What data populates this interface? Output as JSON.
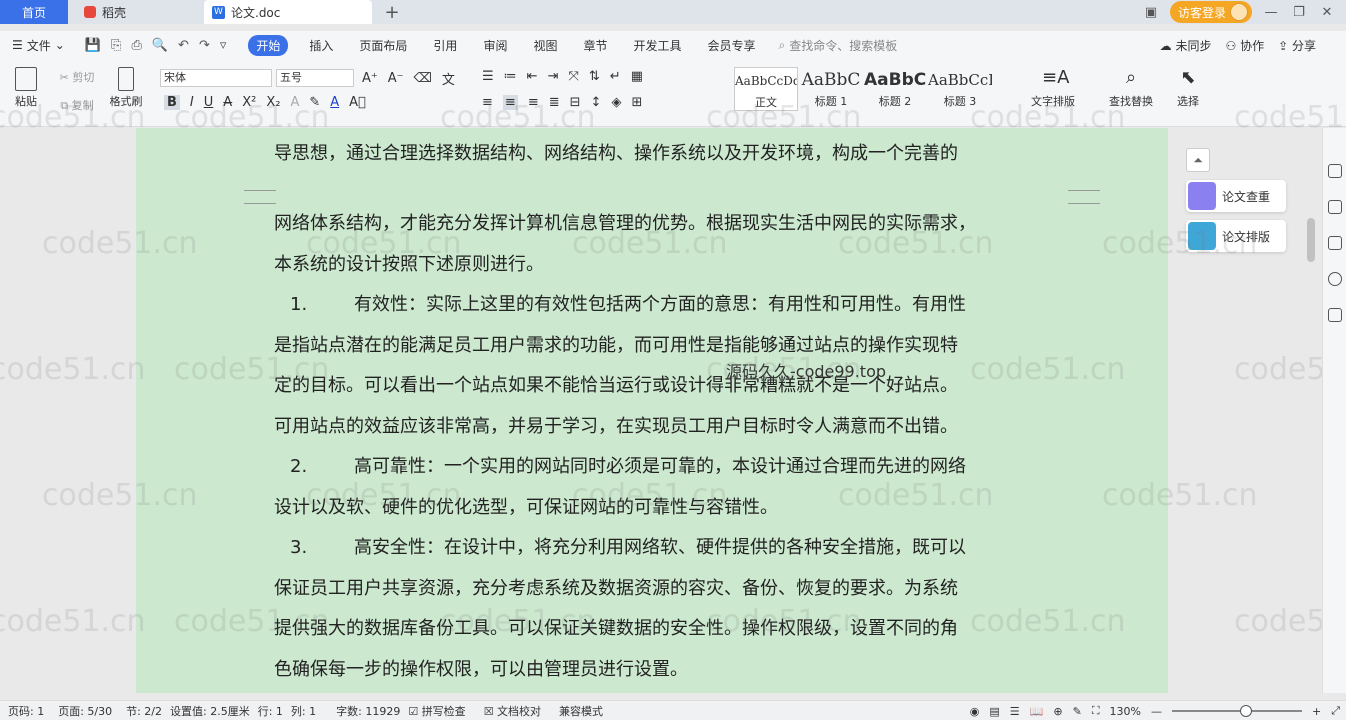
{
  "tabs": {
    "home": "首页",
    "daoke": "稻壳",
    "doc": "论文.doc",
    "add": "+"
  },
  "title_right": {
    "login": "访客登录"
  },
  "menu": {
    "file": "文件",
    "tabs": [
      "开始",
      "插入",
      "页面布局",
      "引用",
      "审阅",
      "视图",
      "章节",
      "开发工具",
      "会员专享"
    ],
    "search": "查找命令、搜索模板",
    "sync": "未同步",
    "collab": "协作",
    "share": "分享"
  },
  "ribbon": {
    "paste": "粘贴",
    "cut": "剪切",
    "copy": "复制",
    "format_painter": "格式刷",
    "font_name": "宋体",
    "font_size": "五号",
    "styles": [
      {
        "sample": "AaBbCcDd",
        "name": "正文"
      },
      {
        "sample": "AaBbC",
        "name": "标题 1"
      },
      {
        "sample": "AaBbC",
        "name": "标题 2"
      },
      {
        "sample": "AaBbCcI",
        "name": "标题 3"
      }
    ],
    "text_layout": "文字排版",
    "find_replace": "查找替换",
    "select": "选择"
  },
  "document": {
    "lines": [
      "导思想，通过合理选择数据结构、网络结构、操作系统以及开发环境，构成一个完善的",
      "网络体系结构，才能充分发挥计算机信息管理的优势。根据现实生活中网民的实际需求，",
      "本系统的设计按照下述原则进行。",
      "有效性：实际上这里的有效性包括两个方面的意思：有用性和可用性。有用性",
      "是指站点潜在的能满足员工用户需求的功能，而可用性是指能够通过站点的操作实现特",
      "定的目标。可以看出一个站点如果不能恰当运行或设计得非常糟糕就不是一个好站点。",
      "可用站点的效益应该非常高，并易于学习，在实现员工用户目标时令人满意而不出错。",
      "高可靠性：一个实用的网站同时必须是可靠的，本设计通过合理而先进的网络",
      "设计以及软、硬件的优化选型，可保证网站的可靠性与容错性。",
      "高安全性：在设计中，将充分利用网络软、硬件提供的各种安全措施，既可以",
      "保证员工用户共享资源，充分考虑系统及数据资源的容灾、备份、恢复的要求。为系统",
      "提供强大的数据库备份工具。可以保证关键数据的安全性。操作权限级，设置不同的角",
      "色确保每一步的操作权限，可以由管理员进行设置。"
    ],
    "numbers": [
      "1.",
      "2.",
      "3."
    ],
    "watermark": "code51.cn",
    "center_watermark": "源码久久-code99.top"
  },
  "side_panel": {
    "check": "论文查重",
    "layout": "论文排版"
  },
  "status": {
    "page_no": "页码: 1",
    "page": "页面: 5/30",
    "section": "节: 2/2",
    "setting": "设置值: 2.5厘米",
    "row": "行: 1",
    "col": "列: 1",
    "words": "字数: 11929",
    "spell": "拼写检查",
    "proof": "文档校对",
    "compat": "兼容模式",
    "zoom": "130%"
  }
}
